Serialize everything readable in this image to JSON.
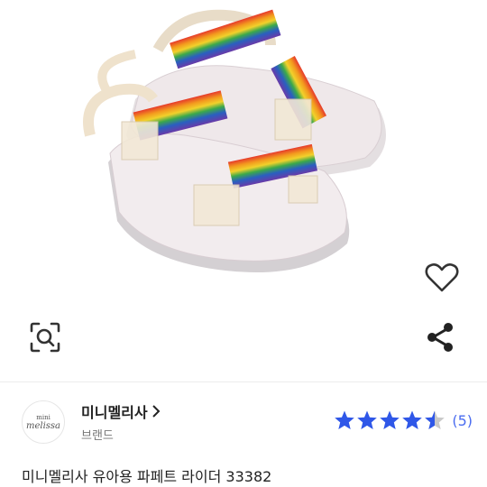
{
  "product": {
    "image_alt": "Rainbow strap jelly sandals (mini melissa)",
    "title": "미니멜리사 유아용 파페트 라이더 33382"
  },
  "actions": {
    "wishlist_icon": "heart-outline-icon",
    "image_search_icon": "lens-search-icon",
    "share_icon": "share-icon"
  },
  "brand": {
    "logo_line1": "mini",
    "logo_line2": "melissa",
    "name": "미니멜리사",
    "label": "브랜드"
  },
  "rating": {
    "value": 4.5,
    "max": 5,
    "count_text": "(5)",
    "star_color": "#2f57e8"
  }
}
